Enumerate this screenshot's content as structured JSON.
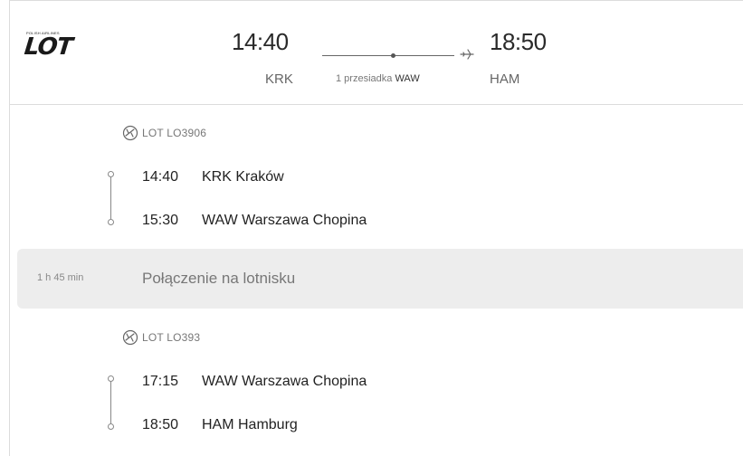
{
  "header": {
    "airline_logo_text": "LOT",
    "airline_logo_tagline": "POLISH AIRLINES",
    "departure_time": "14:40",
    "departure_code": "KRK",
    "arrival_time": "18:50",
    "arrival_code": "HAM",
    "stops_label": "1 przesiadka",
    "stop_airport": "WAW",
    "plane_icon": "plane-icon"
  },
  "segments": [
    {
      "airline_icon": "airline-icon",
      "flight": "LOT LO3906",
      "from": {
        "time": "14:40",
        "place": "KRK Kraków"
      },
      "to": {
        "time": "15:30",
        "place": "WAW Warszawa Chopina"
      }
    },
    {
      "airline_icon": "airline-icon",
      "flight": "LOT LO393",
      "from": {
        "time": "17:15",
        "place": "WAW Warszawa Chopina"
      },
      "to": {
        "time": "18:50",
        "place": "HAM Hamburg"
      }
    }
  ],
  "layover": {
    "duration": "1 h 45 min",
    "message": "Połączenie na lotnisku"
  },
  "colors": {
    "text": "#222222",
    "muted": "#777777",
    "divider": "#dcdcdc",
    "layover_bg": "#ededed"
  }
}
